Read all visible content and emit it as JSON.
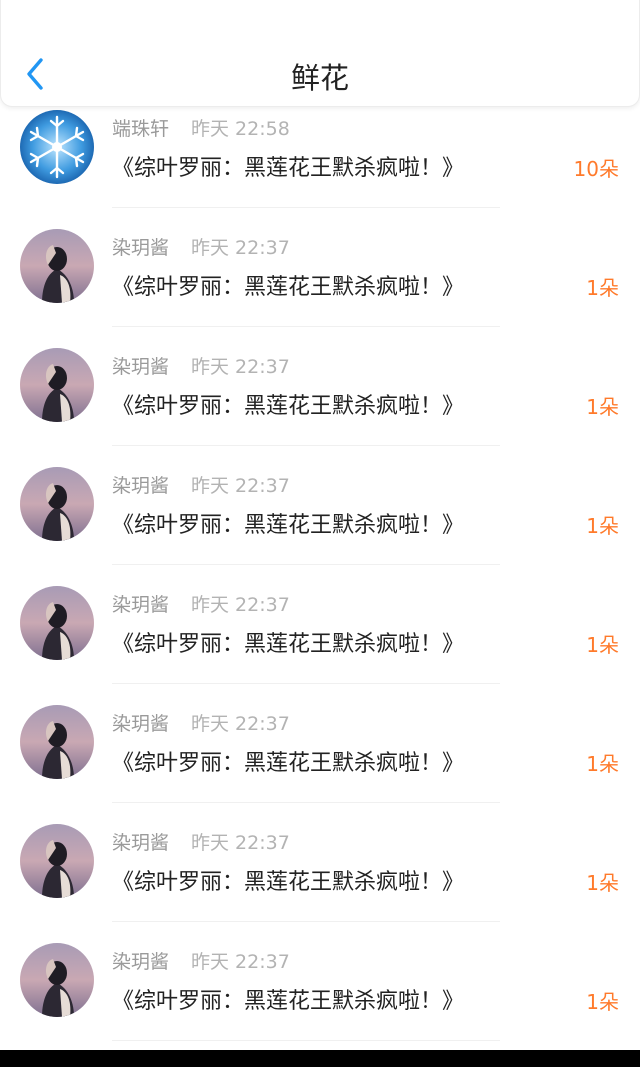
{
  "header": {
    "title": "鲜花",
    "back_icon": "chevron-left-icon",
    "accent_color": "#2196f3"
  },
  "count_color": "#ff7a2b",
  "gifts": [
    {
      "name": "端珠轩",
      "time": "昨天 22:58",
      "title": "《综叶罗丽：黑莲花王默杀疯啦！》",
      "count": "10朵",
      "avatar": "snowflake"
    },
    {
      "name": "染玥酱",
      "time": "昨天 22:37",
      "title": "《综叶罗丽：黑莲花王默杀疯啦！》",
      "count": "1朵",
      "avatar": "girl-portrait"
    },
    {
      "name": "染玥酱",
      "time": "昨天 22:37",
      "title": "《综叶罗丽：黑莲花王默杀疯啦！》",
      "count": "1朵",
      "avatar": "girl-portrait"
    },
    {
      "name": "染玥酱",
      "time": "昨天 22:37",
      "title": "《综叶罗丽：黑莲花王默杀疯啦！》",
      "count": "1朵",
      "avatar": "girl-portrait"
    },
    {
      "name": "染玥酱",
      "time": "昨天 22:37",
      "title": "《综叶罗丽：黑莲花王默杀疯啦！》",
      "count": "1朵",
      "avatar": "girl-portrait"
    },
    {
      "name": "染玥酱",
      "time": "昨天 22:37",
      "title": "《综叶罗丽：黑莲花王默杀疯啦！》",
      "count": "1朵",
      "avatar": "girl-portrait"
    },
    {
      "name": "染玥酱",
      "time": "昨天 22:37",
      "title": "《综叶罗丽：黑莲花王默杀疯啦！》",
      "count": "1朵",
      "avatar": "girl-portrait"
    },
    {
      "name": "染玥酱",
      "time": "昨天 22:37",
      "title": "《综叶罗丽：黑莲花王默杀疯啦！》",
      "count": "1朵",
      "avatar": "girl-portrait"
    }
  ]
}
